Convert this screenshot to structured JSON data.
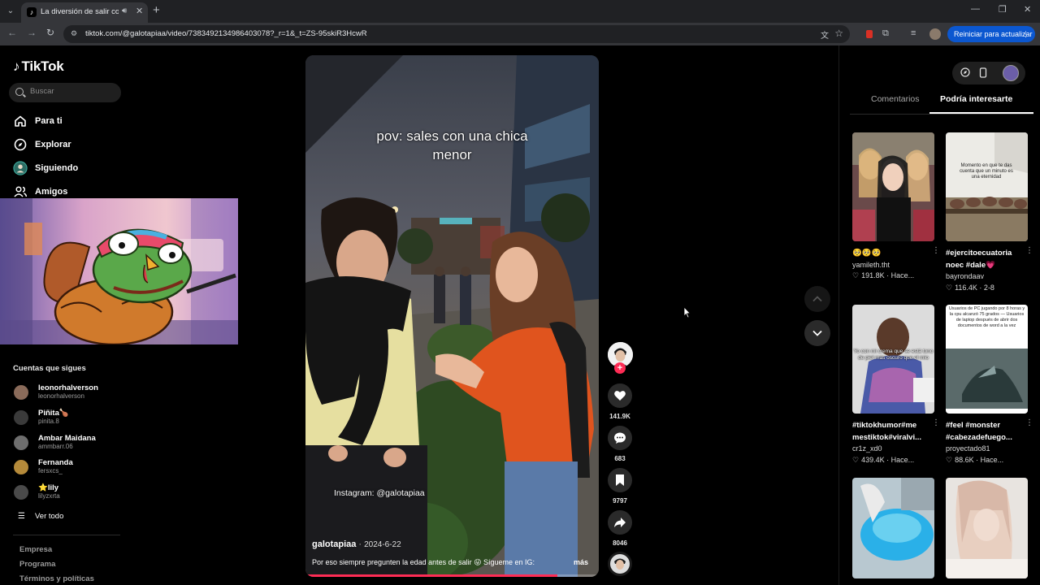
{
  "browser": {
    "tab_title": "La diversión de salir con alg",
    "url": "tiktok.com/@galotapiaa/video/7383492134986403078?_r=1&_t=ZS-95skiR3HcwR",
    "update_button": "Reiniciar para actualizar"
  },
  "sidebar": {
    "logo": "TikTok",
    "search_placeholder": "Buscar",
    "nav": [
      {
        "label": "Para ti",
        "icon": "home-icon"
      },
      {
        "label": "Explorar",
        "icon": "compass-icon"
      },
      {
        "label": "Siguiendo",
        "icon": "following-icon"
      },
      {
        "label": "Amigos",
        "icon": "friends-icon"
      }
    ],
    "following_title": "Cuentas que sigues",
    "accounts": [
      {
        "name": "leonorhalverson",
        "handle": "leonorhalverson"
      },
      {
        "name": "Piñita🍗",
        "handle": "pinita.8"
      },
      {
        "name": "Ambar Maidana",
        "handle": "ammbarr.06"
      },
      {
        "name": "Fernanda",
        "handle": "fersxcs_"
      },
      {
        "name": "⭐lily",
        "handle": "lilyzxrta"
      }
    ],
    "see_all": "Ver todo",
    "footer_links": [
      "Empresa",
      "Programa",
      "Términos y políticas"
    ]
  },
  "video": {
    "overlay_line1": "pov: sales con una chica",
    "overlay_line2": "menor",
    "instagram_text": "Instagram: @galotapiaa",
    "author": "galotapiaa",
    "date": "2024-6-22",
    "caption": "Por eso siempre pregunten la edad antes de salir 😜 Sígueme en IG:",
    "more": "más",
    "progress": 0.86
  },
  "actions": {
    "likes": "141.9K",
    "comments": "683",
    "saves": "9797",
    "shares": "8046"
  },
  "right_panel": {
    "tab_comments": "Comentarios",
    "tab_suggested": "Podría interesarte",
    "cards": [
      {
        "title": "🥺🥺🥺",
        "author": "yamileth.tht",
        "stats": "191.8K · Hace..."
      },
      {
        "title": "#ejercitoecuatoria noec #dale💗",
        "author": "bayrondaav",
        "stats": "116.4K · 2-8"
      },
      {
        "title": "#tiktokhumor#me mestiktok#viralvi...",
        "author": "cr1z_xd0",
        "stats": "439.4K · Hace..."
      },
      {
        "title": "#feel #monster #cabezadefuego...",
        "author": "proyectado81",
        "stats": "88.6K · Hace..."
      }
    ],
    "thumb_texts": {
      "card2": "Momento en que te das cuenta que un minuto es una eternidad",
      "card3": "Yo con mi crema que se está tono de piel más oscuro que el mío",
      "card4": "Usuarios de PC jugando por 8 horas y la cpu alcanzó 75 grados — Usuarios de laptop después de abrir dos documentos de word a la vez"
    }
  },
  "colors": {
    "accent": "#fe2c55",
    "background": "#000000",
    "update_blue": "#0b57d0"
  }
}
